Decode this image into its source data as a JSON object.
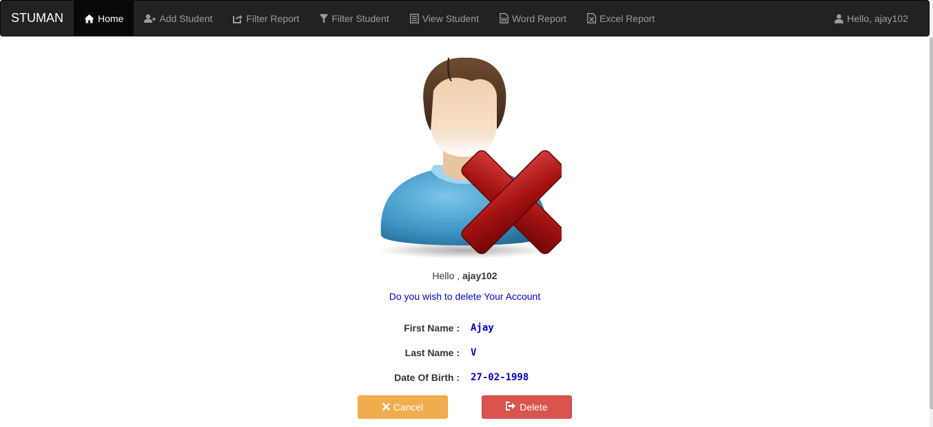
{
  "navbar": {
    "brand": "STUMAN",
    "items": [
      {
        "label": "Home",
        "icon": "home-icon",
        "active": true
      },
      {
        "label": "Add Student",
        "icon": "add-user-icon"
      },
      {
        "label": "Filter Report",
        "icon": "share-icon"
      },
      {
        "label": "Filter Student",
        "icon": "filter-icon"
      },
      {
        "label": "View Student",
        "icon": "list-icon"
      },
      {
        "label": "Word Report",
        "icon": "word-file-icon"
      },
      {
        "label": "Excel Report",
        "icon": "excel-file-icon"
      }
    ],
    "user": {
      "label": "Hello, ajay102",
      "icon": "user-icon"
    }
  },
  "main": {
    "hello_prefix": "Hello ,",
    "username": "ajay102",
    "question": "Do you wish to delete Your Account",
    "fields": [
      {
        "label": "First Name :",
        "value": "Ajay"
      },
      {
        "label": "Last Name :",
        "value": "V"
      },
      {
        "label": "Date Of Birth :",
        "value": "27-02-1998"
      }
    ],
    "cancel_label": "Cancel",
    "delete_label": "Delete"
  },
  "colors": {
    "navbar_bg": "#222222",
    "cancel": "#f0ad4e",
    "delete": "#d9534f",
    "value_text": "#0000cc"
  }
}
